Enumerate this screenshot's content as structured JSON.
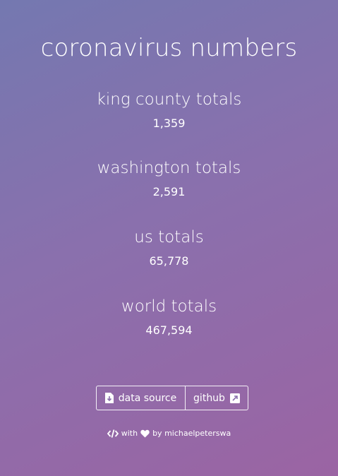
{
  "title": "coronavirus numbers",
  "stats": [
    {
      "label": "king county totals",
      "value": "1,359"
    },
    {
      "label": "washington totals",
      "value": "2,591"
    },
    {
      "label": "us totals",
      "value": "65,778"
    },
    {
      "label": "world totals",
      "value": "467,594"
    }
  ],
  "buttons": {
    "data_source": {
      "label": "data source",
      "icon": "file-download-icon"
    },
    "github": {
      "label": "github",
      "icon": "external-link-icon"
    }
  },
  "footer": {
    "code_icon": "code-icon",
    "with_text": "with",
    "heart_icon": "heart-icon",
    "by_text": "by michaelpeterswa"
  }
}
